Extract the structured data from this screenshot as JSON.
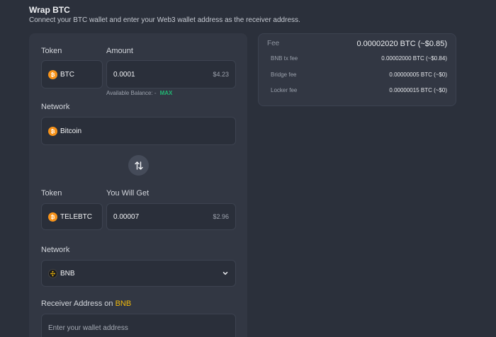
{
  "header": {
    "title": "Wrap BTC",
    "subtitle": "Connect your BTC wallet and enter your Web3 wallet address as the receiver address."
  },
  "source": {
    "token_label": "Token",
    "amount_label": "Amount",
    "token": "BTC",
    "amount": "0.0001",
    "amount_usd": "$4.23",
    "available_balance_label": "Available Balance: -",
    "max_label": "MAX",
    "network_label": "Network",
    "network": "Bitcoin"
  },
  "destination": {
    "token_label": "Token",
    "get_label": "You Will Get",
    "token": "TELEBTC",
    "amount": "0.00007",
    "amount_usd": "$2.96",
    "network_label": "Network",
    "network": "BNB"
  },
  "receiver": {
    "label_prefix": "Receiver Address on",
    "label_network": "BNB",
    "placeholder": "Enter your wallet address"
  },
  "fees": {
    "title": "Fee",
    "total": "0.00002020 BTC (~$0.85)",
    "items": [
      {
        "label": "BNB tx fee",
        "value": "0.00002000 BTC (~$0.84)"
      },
      {
        "label": "Bridge fee",
        "value": "0.00000005 BTC (~$0)"
      },
      {
        "label": "Locker fee",
        "value": "0.00000015 BTC (~$0)"
      }
    ]
  },
  "colors": {
    "accent_green": "#22b573",
    "bnb_yellow": "#f0b90b",
    "btc_orange": "#f7931a"
  },
  "icons": {
    "btc": "bitcoin-icon",
    "bnb": "bnb-icon",
    "swap": "swap-arrows-icon",
    "dropdown": "chevron-down-icon"
  }
}
